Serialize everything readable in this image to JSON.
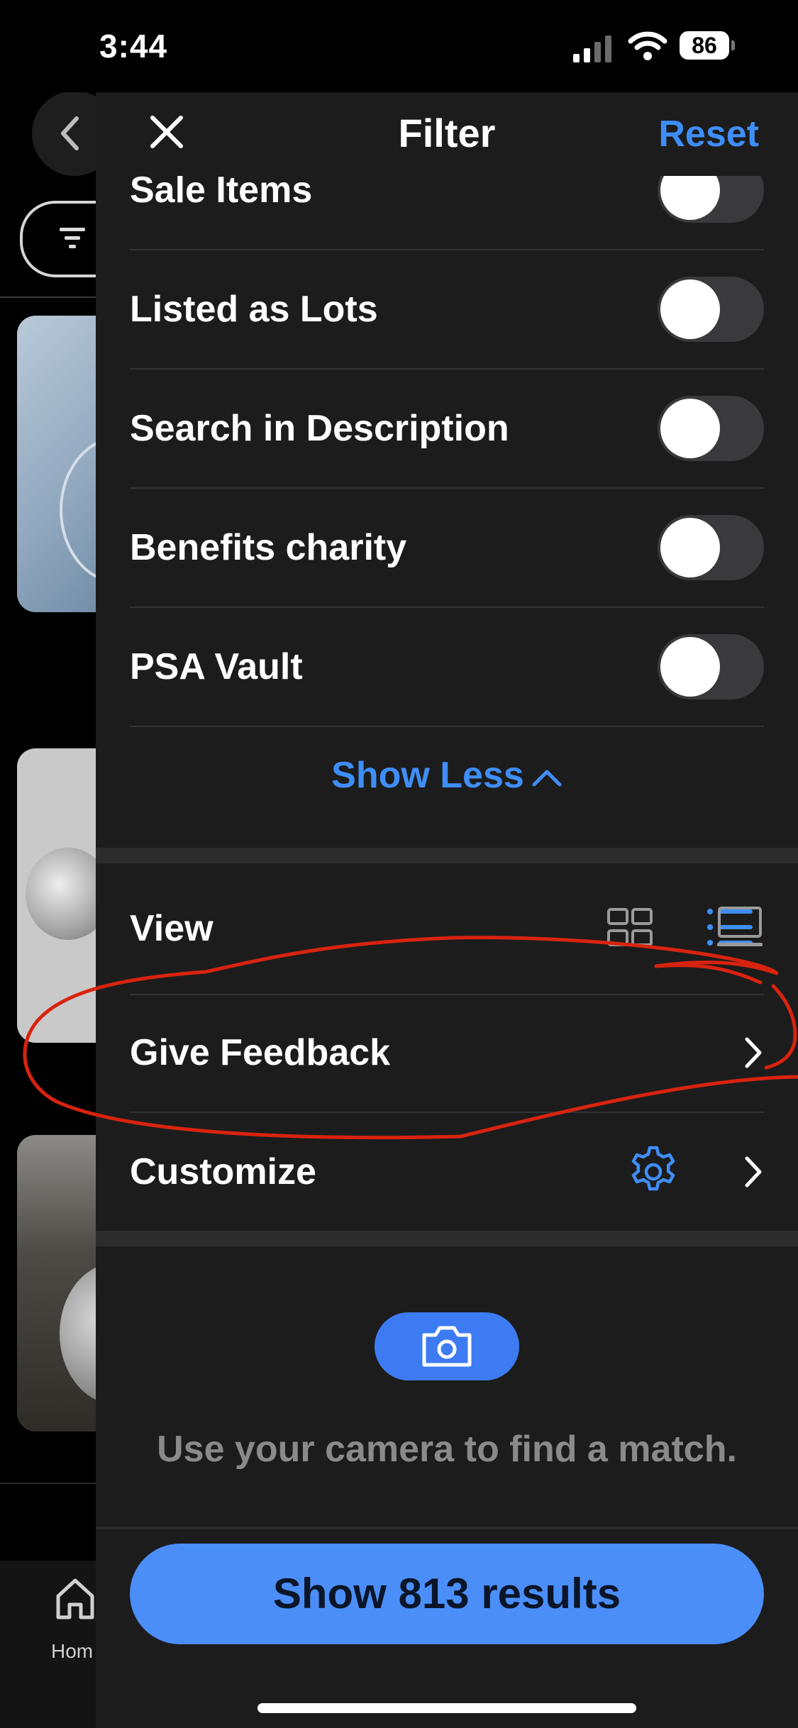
{
  "status_bar": {
    "time": "3:44",
    "battery": "86"
  },
  "background": {
    "tab_home_label": "Hom"
  },
  "header": {
    "title": "Filter",
    "reset_label": "Reset"
  },
  "toggles": [
    {
      "label": "Sale Items",
      "on": false
    },
    {
      "label": "Listed as Lots",
      "on": false
    },
    {
      "label": "Search in Description",
      "on": false
    },
    {
      "label": "Benefits charity",
      "on": false
    },
    {
      "label": "PSA Vault",
      "on": false
    }
  ],
  "show_less_label": "Show Less",
  "view": {
    "label": "View",
    "options": [
      "grid-view-icon",
      "list-view-icon",
      "gallery-view-icon"
    ],
    "selected": "list-view-icon"
  },
  "give_feedback_label": "Give Feedback",
  "customize_label": "Customize",
  "camera": {
    "text": "Use your camera to find a match."
  },
  "show_results_label": "Show 813 results",
  "colors": {
    "accent": "#3f8ef7",
    "button": "#4b8ef8",
    "sheet": "#1c1c1c",
    "annotation": "#d8230f"
  }
}
